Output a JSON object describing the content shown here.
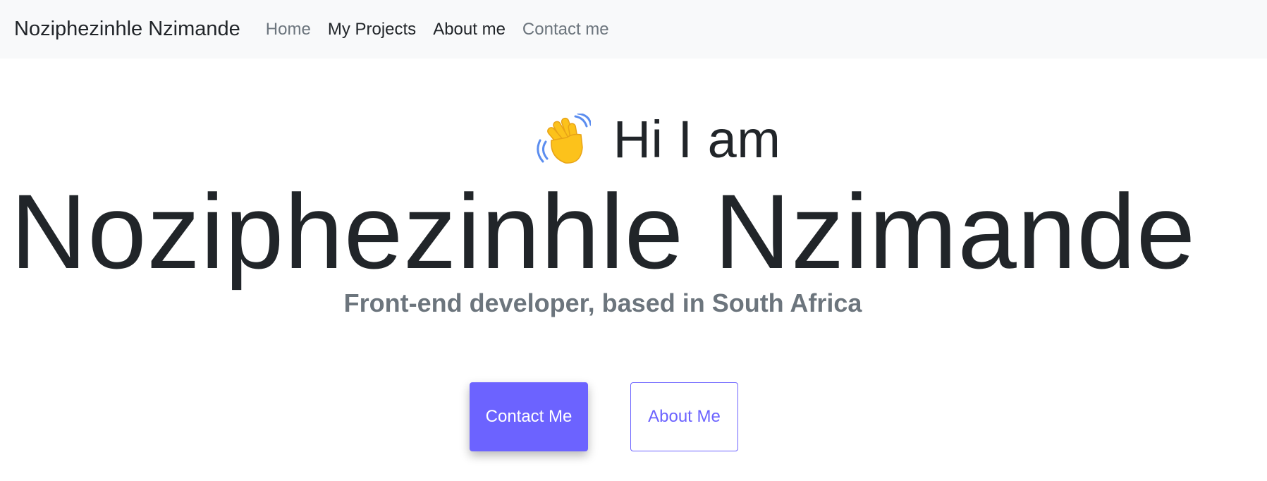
{
  "navbar": {
    "brand": "Noziphezinhle Nzimande",
    "links": [
      {
        "label": "Home"
      },
      {
        "label": "My Projects"
      },
      {
        "label": "About me"
      },
      {
        "label": "Contact me"
      }
    ]
  },
  "hero": {
    "wave_icon": "waving-hand-icon",
    "greeting": "Hi I am",
    "name": "Noziphezinhle Nzimande",
    "subtitle": "Front-end developer, based in South Africa",
    "buttons": {
      "contact": "Contact Me",
      "about": "About Me"
    }
  },
  "colors": {
    "navbar_bg": "#f8f9fa",
    "text_dark": "#212529",
    "text_muted": "#6c757d",
    "accent": "#6c63ff"
  }
}
